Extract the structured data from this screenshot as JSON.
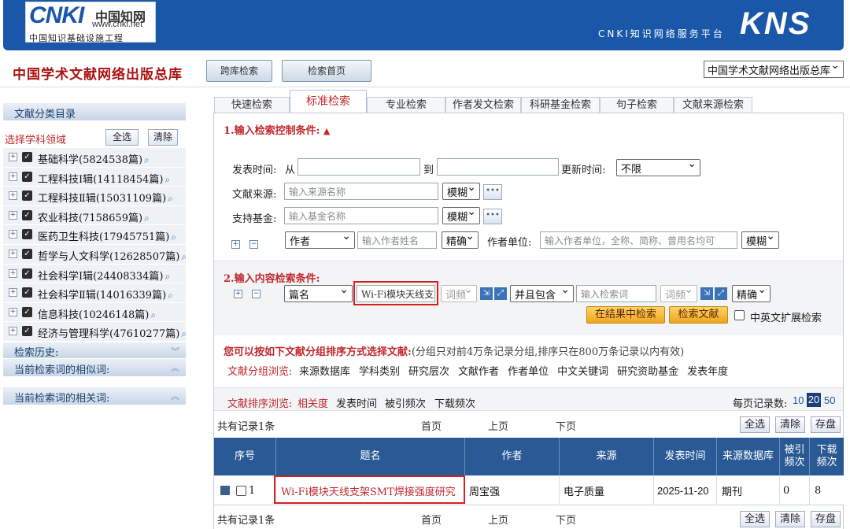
{
  "header": {
    "logo_mark": "CNKI",
    "logo_cn": "中国知网",
    "logo_url": "www.cnki.net",
    "logo_sub": "中国知识基础设施工程",
    "platform": "CNKI知识网络服务平台",
    "kns": "KNS"
  },
  "topbar": {
    "db_title": "中国学术文献网络出版总库",
    "cross_search": "跨库检索",
    "search_home": "检索首页",
    "db_select": "中国学术文献网络出版总库"
  },
  "sidebar": {
    "catalog_title": "文献分类目录",
    "select_field": "选择学科领域",
    "select_all": "全选",
    "clear": "清除",
    "categories": [
      {
        "label": "基础科学(5824538篇)"
      },
      {
        "label": "工程科技Ⅰ辑(14118454篇)"
      },
      {
        "label": "工程科技Ⅱ辑(15031109篇)"
      },
      {
        "label": "农业科技(7158659篇)"
      },
      {
        "label": "医药卫生科技(17945751篇)"
      },
      {
        "label": "哲学与人文科学(12628507篇)"
      },
      {
        "label": "社会科学Ⅰ辑(24408334篇)"
      },
      {
        "label": "社会科学Ⅱ辑(14016339篇)"
      },
      {
        "label": "信息科技(10246148篇)"
      },
      {
        "label": "经济与管理科学(47610277篇)"
      }
    ],
    "history": "检索历史:",
    "similar": "当前检索词的相似词:",
    "related": "当前检索词的相关词:"
  },
  "tabs": [
    "快速检索",
    "标准检索",
    "专业检索",
    "作者发文检索",
    "科研基金检索",
    "句子检索",
    "文献来源检索"
  ],
  "control": {
    "title": "1.输入检索控制条件:",
    "pub_time": "发表时间:",
    "from": "从",
    "to": "到",
    "update_time": "更新时间:",
    "update_value": "不限",
    "source": "文献来源:",
    "source_ph": "输入来源名称",
    "source_mode": "模糊",
    "fund": "支持基金:",
    "fund_ph": "输入基金名称",
    "fund_mode": "模糊",
    "author_field": "作者",
    "author_ph": "输入作者姓名",
    "author_mode": "精确",
    "unit": "作者单位:",
    "unit_ph": "输入作者单位，全称、简称、曾用名均可",
    "unit_mode": "模糊"
  },
  "content": {
    "title": "2.输入内容检索条件:",
    "field": "篇名",
    "keyword": "Wi-Fi模块天线支",
    "freq": "词频",
    "logic": "并且包含",
    "kw2_ph": "输入检索词",
    "freq2": "词频",
    "match": "精确",
    "search_in_results": "在结果中检索",
    "search": "检索文献",
    "expand": "中英文扩展检索"
  },
  "grouping": {
    "notice": "您可以按如下文献分组排序方式选择文献:",
    "notice_note": "(分组只对前4万条记录分组,排序只在800万条记录以内有效)",
    "browse_label": "文献分组浏览:",
    "groups": [
      "来源数据库",
      "学科类别",
      "研究层次",
      "文献作者",
      "作者单位",
      "中文关键词",
      "研究资助基金",
      "发表年度"
    ]
  },
  "sorting": {
    "label": "文献排序浏览:",
    "options": [
      "相关度",
      "发表时间",
      "被引频次",
      "下载频次"
    ],
    "per_page_label": "每页记录数:",
    "per_page": [
      "10",
      "20",
      "50"
    ]
  },
  "results": {
    "count": "共有记录1条",
    "first": "首页",
    "prev": "上页",
    "next": "下页",
    "select_all": "全选",
    "clear": "清除",
    "save": "存盘",
    "headers": [
      "序号",
      "题名",
      "作者",
      "来源",
      "发表时间",
      "来源数据库",
      "被引频次",
      "下载频次"
    ],
    "rows": [
      {
        "no": "1",
        "title": "Wi-Fi模块天线支架SMT焊接强度研究",
        "author": "周宝强",
        "source": "电子质量",
        "date": "2025-11-20",
        "db": "期刊",
        "cited": "0",
        "downloads": "8"
      }
    ]
  },
  "colors": {
    "brand": "#1a57a8",
    "accent": "#c0282d",
    "table_header": "#2a5a96",
    "highlight": "#d62020"
  }
}
